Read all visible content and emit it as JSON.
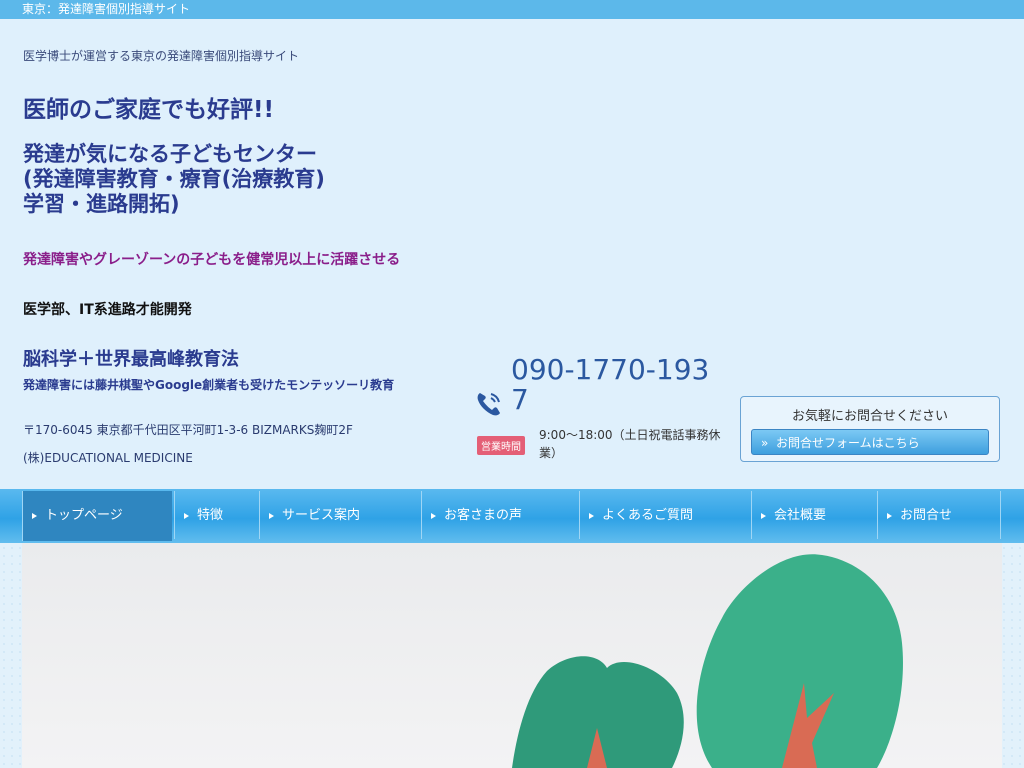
{
  "topbar": {
    "title": "東京：発達障害個別指導サイト"
  },
  "header": {
    "tagline": "医学博士が運営する東京の発達障害個別指導サイト",
    "headline": "医師のご家庭でも好評!!",
    "center_lines": [
      "発達が気になる子どもセンター",
      "(発達障害教育・療育(治療教育)",
      "学習・進路開拓)"
    ],
    "purple_text": "発達障害やグレーゾーンの子どもを健常児以上に活躍させる",
    "black_text": "医学部、IT系進路才能開発",
    "method_title": "脳科学＋世界最高峰教育法",
    "method_sub": "発達障害には藤井棋聖やGoogle創業者も受けたモンテッソーリ教育",
    "address": "〒170-6045 東京都千代田区平河町1-3-6 BIZMARKS麹町2F",
    "company": "(株)EDUCATIONAL MEDICINE"
  },
  "contact": {
    "phone": "090-1770-1937",
    "hours_badge": "営業時間",
    "hours": "9:00〜18:00（土日祝電話事務休業）",
    "box_label": "お気軽にお問合せください",
    "form_button": "お問合せフォームはこちら"
  },
  "nav": {
    "items": [
      {
        "label": "トップページ"
      },
      {
        "label": "特徴"
      },
      {
        "label": "サービス案内"
      },
      {
        "label": "お客さまの声"
      },
      {
        "label": "よくあるご質問"
      },
      {
        "label": "会社概要"
      },
      {
        "label": "お問合せ"
      }
    ]
  },
  "colors": {
    "accent": "#2fa2e6",
    "headline": "#2a3b8f",
    "purple": "#8a1e8a",
    "badge": "#e45f76"
  },
  "icons": {
    "phone": "phone-icon"
  }
}
